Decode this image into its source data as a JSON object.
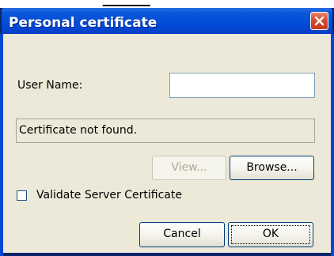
{
  "window": {
    "title": "Personal certificate"
  },
  "form": {
    "user_name_label": "User Name:",
    "user_name_value": "",
    "status_text": "Certificate not found.",
    "view_button": "View...",
    "browse_button": "Browse...",
    "validate_checkbox_label": "Validate Server Certificate",
    "validate_checked": false
  },
  "footer": {
    "cancel_button": "Cancel",
    "ok_button": "OK"
  },
  "icons": {
    "close": "close-icon",
    "checkbox": "checkbox-icon"
  },
  "colors": {
    "titlebar": "#0049d6",
    "dialog_face": "#ece9d8",
    "close_button": "#d5492c"
  }
}
